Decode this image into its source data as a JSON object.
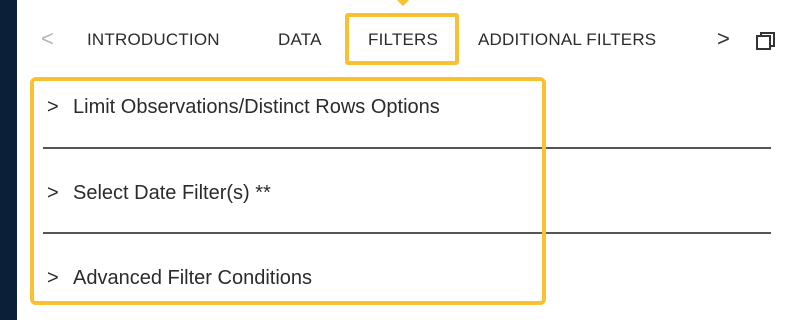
{
  "tabs": {
    "prev_glyph": "<",
    "next_glyph": ">",
    "items": [
      {
        "label": "INTRODUCTION"
      },
      {
        "label": "DATA"
      },
      {
        "label": "FILTERS"
      },
      {
        "label": "ADDITIONAL FILTERS"
      }
    ],
    "active_index": 2
  },
  "icons": {
    "prev": "chevron-left-icon",
    "next": "chevron-right-icon",
    "window": "restore-window-icon",
    "section_expand": "chevron-right-icon"
  },
  "sections": [
    {
      "chevron": ">",
      "title": "Limit Observations/Distinct Rows Options"
    },
    {
      "chevron": ">",
      "title": "Select Date Filter(s) **"
    },
    {
      "chevron": ">",
      "title": "Advanced Filter Conditions"
    }
  ],
  "colors": {
    "background": "#0b2038",
    "highlight": "#f7c132",
    "panel": "#ffffff"
  }
}
